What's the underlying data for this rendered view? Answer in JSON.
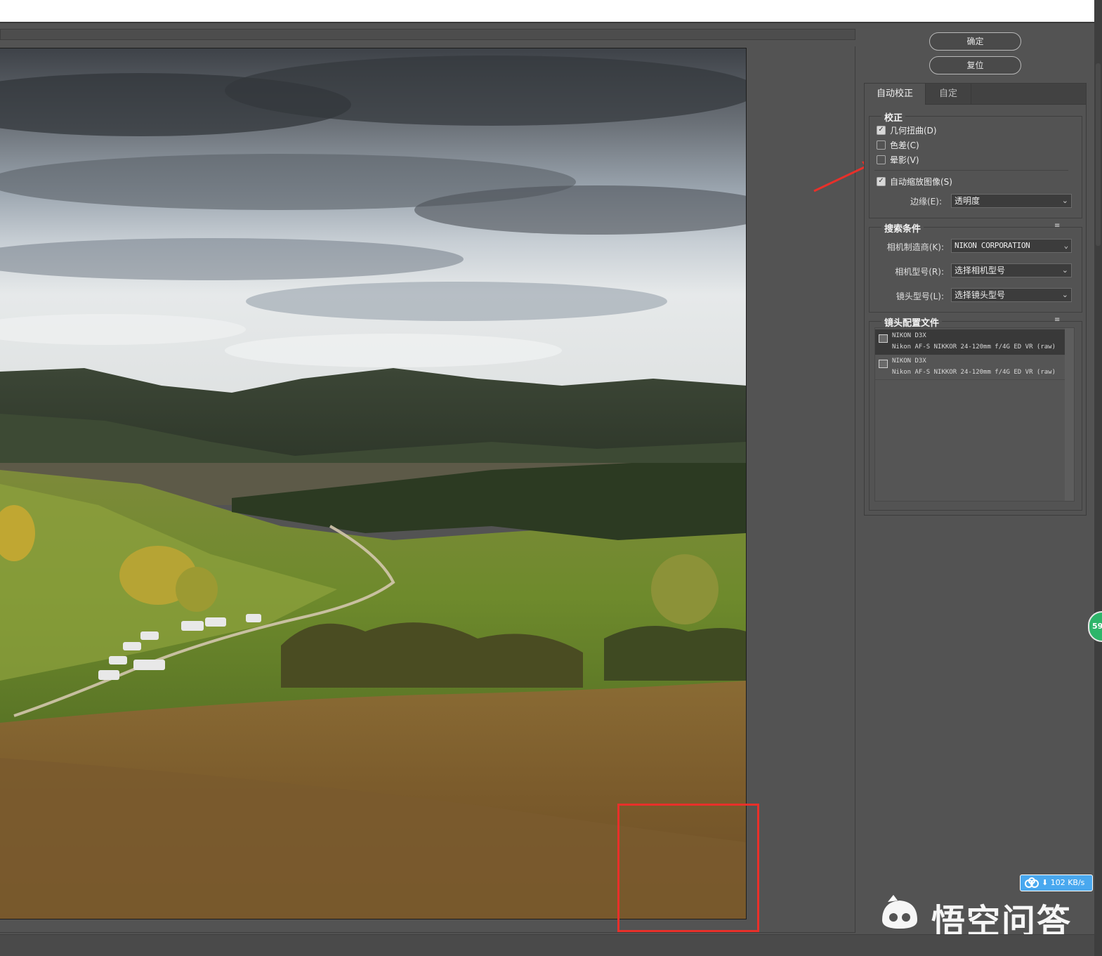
{
  "buttons": {
    "ok": "确定",
    "reset": "复位"
  },
  "tabs": {
    "auto": "自动校正",
    "custom": "自定"
  },
  "correction": {
    "title": "校正",
    "geometric": {
      "label": "几何扭曲(D)",
      "checked": true
    },
    "chromatic": {
      "label": "色差(C)",
      "checked": false
    },
    "vignette": {
      "label": "晕影(V)",
      "checked": false
    },
    "auto_scale": {
      "label": "自动缩放图像(S)",
      "checked": true
    },
    "edge_label": "边缘(E):",
    "edge_value": "透明度"
  },
  "search": {
    "title": "搜索条件",
    "make_label": "相机制造商(K):",
    "make_value": "NIKON CORPORATION",
    "model_label": "相机型号(R):",
    "model_value": "选择相机型号",
    "lens_label": "镜头型号(L):",
    "lens_value": "选择镜头型号"
  },
  "profiles": {
    "title": "镜头配置文件",
    "items": [
      {
        "camera": "NIKON D3X",
        "lens": "Nikon AF-S NIKKOR 24-120mm f/4G ED VR (raw)"
      },
      {
        "camera": "NIKON D3X",
        "lens": "Nikon AF-S NIKKOR 24-120mm f/4G ED VR (raw)"
      }
    ]
  },
  "icons": {
    "menu": "≡",
    "chevron": "⌄",
    "check": "✓",
    "download": "⬇"
  },
  "badges": {
    "green_count": "59",
    "speed": "102 KB/s"
  },
  "watermark": "悟空问答",
  "colors": {
    "annotation_red": "#e8302a",
    "speed_blue": "#49a8ef",
    "badge_green": "#2db56a"
  }
}
